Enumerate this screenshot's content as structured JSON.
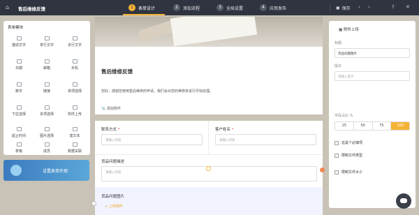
{
  "header": {
    "app_title": "售后维修反馈",
    "steps": [
      {
        "num": "1",
        "label": "表单设计"
      },
      {
        "num": "2",
        "label": "添加流程"
      },
      {
        "num": "3",
        "label": "全局设置"
      },
      {
        "num": "4",
        "label": "应用发布"
      }
    ],
    "save_label": "保存",
    "accent": "#f5b335"
  },
  "palette": {
    "title": "表单模块",
    "widgets": [
      "描述文字",
      "单行文字",
      "多行文字",
      "日期",
      "邮箱",
      "手机",
      "数字",
      "链接",
      "单项选择",
      "下拉选择",
      "多项选择",
      "附件上传",
      "起止时间",
      "图片选择",
      "富文本",
      "表格",
      "成员",
      "数据关联"
    ],
    "banner": "设置表单外观"
  },
  "form": {
    "title": "售后维修反馈",
    "description": "您好，感谢您使用售后维修的申请，我们会对您的维修单进行尽快处理。",
    "attach_label": "添加附件",
    "contact_label": "联系方式",
    "contact_placeholder": "请输入内容",
    "name_label": "客户姓名",
    "name_placeholder": "请输入内容",
    "issue_label": "货品问题描述",
    "issue_placeholder": "请输入内容",
    "image_label": "货品问题图片",
    "upload_label": "上传附件"
  },
  "props": {
    "title": "附件上传",
    "label_caption": "标题",
    "label_value": "货品问题图片",
    "hint_caption": "提示",
    "hint_placeholder": "请输入提示",
    "width_caption": "字段占比 %",
    "width_options": [
      "25",
      "50",
      "75",
      "100"
    ],
    "selected_width": "100",
    "checks": [
      "这是个必填项",
      "限制文件类型",
      "限制文件大小"
    ]
  }
}
